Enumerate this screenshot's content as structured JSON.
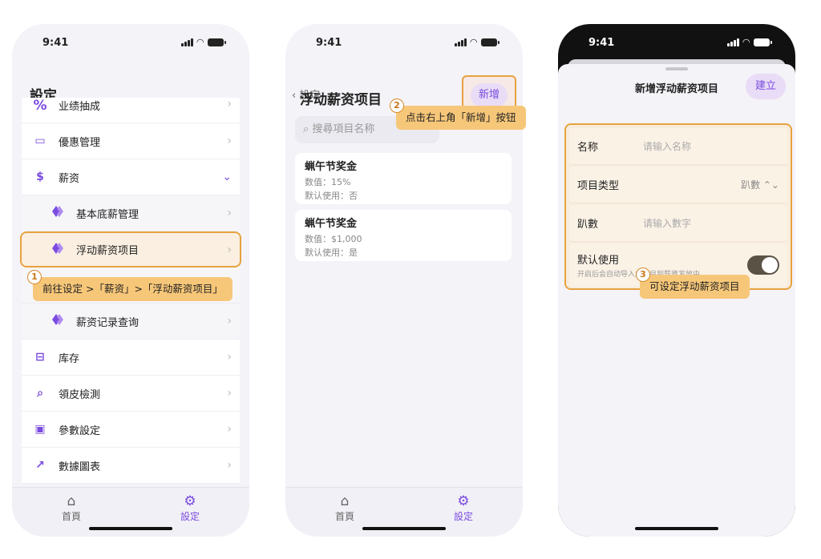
{
  "status": {
    "time": "9:41"
  },
  "tabs": [
    {
      "label": "首頁",
      "icon": "home-icon"
    },
    {
      "label": "設定",
      "icon": "gear-icon"
    }
  ],
  "phone1": {
    "title": "設定",
    "items": [
      {
        "label": "业绩抽成",
        "icon": "percent-icon"
      },
      {
        "label": "優惠管理",
        "icon": "coupon-icon"
      },
      {
        "label": "薪资",
        "icon": "salary-icon"
      },
      {
        "label": "基本底薪管理",
        "icon": "gem-icon"
      },
      {
        "label": "浮动薪资项目",
        "icon": "gem-icon"
      },
      {
        "label": "薪资记录查询",
        "icon": "gem-icon"
      },
      {
        "label": "库存",
        "icon": "archive-icon"
      },
      {
        "label": "領皮檢測",
        "icon": "magnifier-icon"
      },
      {
        "label": "參數設定",
        "icon": "params-icon"
      },
      {
        "label": "數據圖表",
        "icon": "chart-icon"
      }
    ],
    "callout": {
      "number": "1",
      "text": "前往设定 >「薪资」>「浮动薪资项目」"
    }
  },
  "phone2": {
    "back": "設定",
    "new_button": "新增",
    "title": "浮动薪资项目",
    "search_placeholder": "搜尋項目名称",
    "cards": [
      {
        "title": "蝋午节奖金",
        "value": "数值：15%",
        "default": "默认使用：否"
      },
      {
        "title": "蝋午节奖金",
        "value": "数值：$1,000",
        "default": "默认使用：是"
      }
    ],
    "callout": {
      "number": "2",
      "text": "点击右上角「新增」按钮"
    }
  },
  "phone3": {
    "title": "新增浮动薪资项目",
    "create_button": "建立",
    "fields": [
      {
        "label": "名称",
        "placeholder": "请输入名称"
      },
      {
        "label": "项目类型",
        "value": "趴數 ⌃⌄"
      },
      {
        "label": "趴數",
        "placeholder": "请输入數字"
      }
    ],
    "default_use": {
      "label": "默认使用",
      "hint": "开启后会自动导入此项目到薪資发放中",
      "on": true
    },
    "callout": {
      "number": "3",
      "text": "可设定浮动薪资项目"
    }
  },
  "colors": {
    "accent": "#7a4be0",
    "highlight": "#e8a23f",
    "callout_bg": "#f7c779"
  }
}
